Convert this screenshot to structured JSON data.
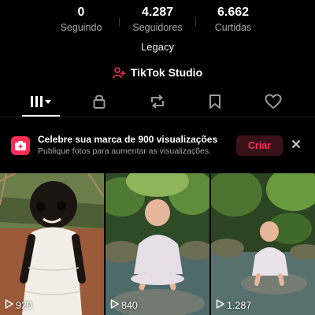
{
  "stats": [
    {
      "value": "0",
      "label": "Seguindo"
    },
    {
      "value": "4.287",
      "label": "Seguidores"
    },
    {
      "value": "6.662",
      "label": "Curtidas"
    }
  ],
  "bio": "Legacy",
  "studio": {
    "label": "TikTok Studio",
    "icon": "person-plus-icon",
    "accent": "#fe2c55"
  },
  "tabs": [
    {
      "icon": "grid-icon",
      "active": true
    },
    {
      "icon": "lock-icon"
    },
    {
      "icon": "repost-icon"
    },
    {
      "icon": "bookmark-icon"
    },
    {
      "icon": "heart-icon"
    }
  ],
  "banner": {
    "title": "Celebre sua marca de 900 visualizações",
    "subtitle": "Publique fotos para aumentar as visualizações.",
    "button": "Criar",
    "close_icon": "close-icon"
  },
  "videos": [
    {
      "views": "920"
    },
    {
      "views": "840"
    },
    {
      "views": "1.287"
    }
  ]
}
